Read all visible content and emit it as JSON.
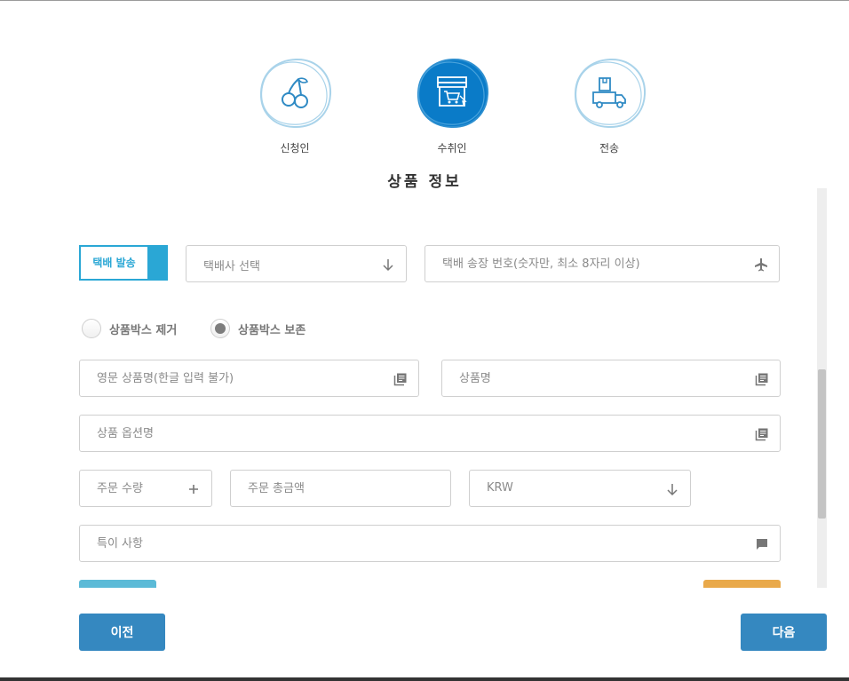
{
  "steps": [
    {
      "label": "신청인",
      "icon": "cherry-icon",
      "active": false
    },
    {
      "label": "수취인",
      "icon": "shop-cart-icon",
      "active": true
    },
    {
      "label": "전송",
      "icon": "delivery-truck-icon",
      "active": false
    }
  ],
  "section": {
    "title": "상품 정보"
  },
  "shipping": {
    "delivery_button_label": "택배 발송",
    "courier_select_label": "택배사 선택",
    "tracking_placeholder": "택배 송장 번호(숫자만, 최소 8자리 이상)"
  },
  "box_options": [
    {
      "label": "상품박스 제거",
      "selected": false
    },
    {
      "label": "상품박스 보존",
      "selected": true
    }
  ],
  "product": {
    "english_name_placeholder": "영문 상품명(한글 입력 불가)",
    "name_placeholder": "상품명",
    "option_placeholder": "상품 옵션명",
    "quantity_placeholder": "주문 수량",
    "total_placeholder": "주문 총금액",
    "currency_value": "KRW",
    "notes_placeholder": "특이 사항"
  },
  "nav": {
    "prev_label": "이전",
    "next_label": "다음"
  },
  "colors": {
    "primary": "#3588c0",
    "accent": "#2aa7d5",
    "step_active": "#0a7bc8",
    "step_inactive_stroke": "#a9d3ea",
    "orange": "#e9a94a"
  }
}
